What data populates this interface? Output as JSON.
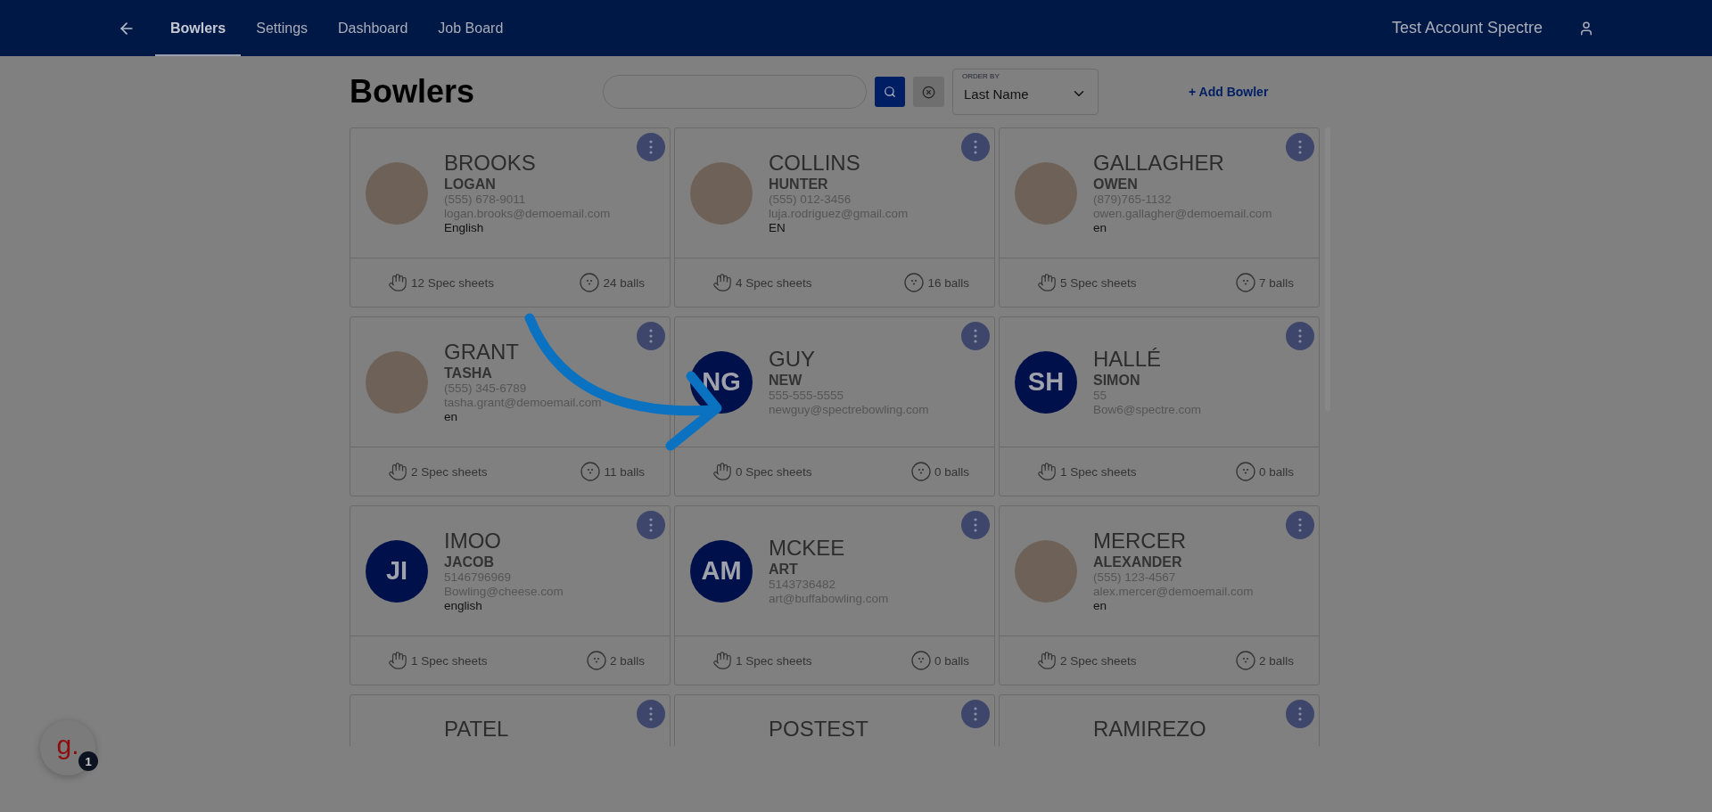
{
  "nav": {
    "items": [
      {
        "label": "Bowlers",
        "selected": true
      },
      {
        "label": "Settings",
        "selected": false
      },
      {
        "label": "Dashboard",
        "selected": false
      },
      {
        "label": "Job Board",
        "selected": false
      }
    ]
  },
  "account": {
    "name": "Test Account Spectre"
  },
  "page": {
    "title": "Bowlers"
  },
  "order_by": {
    "label": "ORDER BY",
    "value": "Last Name"
  },
  "add_button": "+ Add Bowler",
  "bowlers": [
    {
      "last": "BROOKS",
      "first": "LOGAN",
      "phone": "(555) 678-9011",
      "email": "logan.brooks@demoemail.com",
      "language": "English",
      "avatar": {
        "kind": "photo"
      },
      "spec_sheets": "12 Spec sheets",
      "balls": "24 balls"
    },
    {
      "last": "COLLINS",
      "first": "HUNTER",
      "phone": "(555) 012-3456",
      "email": "luja.rodriguez@gmail.com",
      "language": "EN",
      "avatar": {
        "kind": "photo"
      },
      "spec_sheets": "4 Spec sheets",
      "balls": "16 balls"
    },
    {
      "last": "GALLAGHER",
      "first": "OWEN",
      "phone": "(879)765-1132",
      "email": "owen.gallagher@demoemail.com",
      "language": "en",
      "avatar": {
        "kind": "photo"
      },
      "spec_sheets": "5 Spec sheets",
      "balls": "7 balls"
    },
    {
      "last": "GRANT",
      "first": "TASHA",
      "phone": "(555) 345-6789",
      "email": "tasha.grant@demoemail.com",
      "language": "en",
      "avatar": {
        "kind": "photo"
      },
      "spec_sheets": "2 Spec sheets",
      "balls": "11 balls"
    },
    {
      "last": "GUY",
      "first": "NEW",
      "phone": "555-555-5555",
      "email": "newguy@spectrebowling.com",
      "avatar": {
        "kind": "initials",
        "initials": "NG"
      },
      "spec_sheets": "0 Spec sheets",
      "balls": "0 balls"
    },
    {
      "last": "HALLÉ",
      "first": "SIMON",
      "phone": "55",
      "email": "Bow6@spectre.com",
      "avatar": {
        "kind": "initials",
        "initials": "SH"
      },
      "spec_sheets": "1 Spec sheets",
      "balls": "0 balls"
    },
    {
      "last": "IMOO",
      "first": "JACOB",
      "phone": "5146796969",
      "email": "Bowling@cheese.com",
      "language": "english",
      "avatar": {
        "kind": "initials",
        "initials": "JI"
      },
      "spec_sheets": "1 Spec sheets",
      "balls": "2 balls"
    },
    {
      "last": "MCKEE",
      "first": "ART",
      "phone": "5143736482",
      "email": "art@buffabowling.com",
      "avatar": {
        "kind": "initials",
        "initials": "AM"
      },
      "spec_sheets": "1 Spec sheets",
      "balls": "0 balls"
    },
    {
      "last": "MERCER",
      "first": "ALEXANDER",
      "phone": "(555) 123-4567",
      "email": "alex.mercer@demoemail.com",
      "language": "en",
      "avatar": {
        "kind": "photo"
      },
      "spec_sheets": "2 Spec sheets",
      "balls": "2 balls"
    },
    {
      "last": "PATEL"
    },
    {
      "last": "POSTEST"
    },
    {
      "last": "RAMIREZO"
    }
  ],
  "help_widget": {
    "logo": "g.",
    "badge": "1"
  }
}
